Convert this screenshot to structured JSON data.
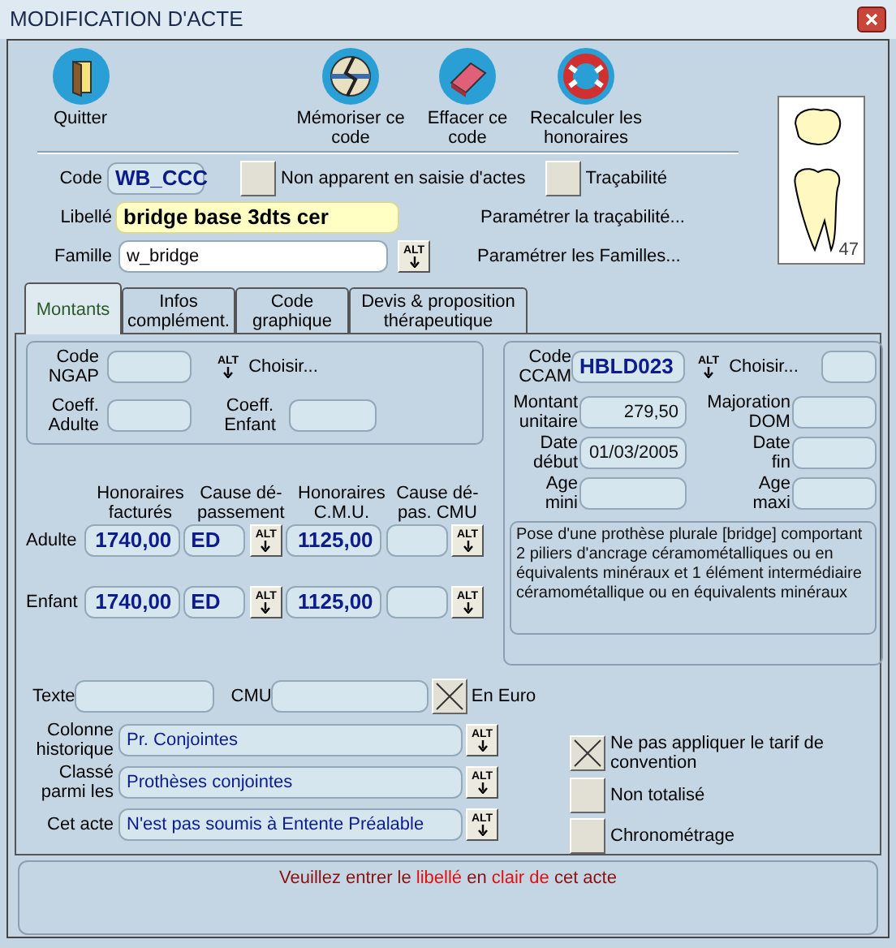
{
  "window": {
    "title": "MODIFICATION D'ACTE"
  },
  "toolbar": [
    {
      "label": "Quitter",
      "kind": "door"
    },
    {
      "label": "Mémoriser ce\ncode",
      "kind": "memorize"
    },
    {
      "label": "Effacer ce\ncode",
      "kind": "eraser"
    },
    {
      "label": "Recalculer les\nhonoraires",
      "kind": "lifebuoy"
    }
  ],
  "tooth": {
    "number": "47"
  },
  "code": {
    "label": "Code",
    "value": "WB_CCC"
  },
  "top_checks": [
    {
      "label": "Non apparent en saisie d'actes",
      "checked": false
    },
    {
      "label": "Traçabilité",
      "checked": false
    }
  ],
  "libelle": {
    "label": "Libellé",
    "value": "bridge base 3dts cer"
  },
  "famille": {
    "label": "Famille",
    "value": "w_bridge",
    "alt": "ALT"
  },
  "links": [
    "Paramétrer la traçabilité...",
    "Paramétrer les Familles..."
  ],
  "tabs": [
    {
      "label": "Montants",
      "selected": true
    },
    {
      "label": "Infos\ncomplément.",
      "selected": false
    },
    {
      "label": "Code\ngraphique",
      "selected": false
    },
    {
      "label": "Devis & proposition\nthérapeutique",
      "selected": false
    }
  ],
  "ngap": {
    "code_label": "Code\nNGAP",
    "alt": "ALT",
    "choose": "Choisir...",
    "coeff_adult_label": "Coeff.\nAdulte",
    "coeff_child_label": "Coeff.\nEnfant"
  },
  "fees": {
    "columns": [
      "Honoraires\nfacturés",
      "Cause dé-\npassement",
      "Honoraires\nC.M.U.",
      "Cause dé-\npas. CMU"
    ],
    "rows": [
      {
        "label": "Adulte",
        "billed": "1740,00",
        "cause": "ED",
        "cause_alt": "ALT",
        "cmu": "1125,00",
        "cmu_cause_alt": "ALT"
      },
      {
        "label": "Enfant",
        "billed": "1740,00",
        "cause": "ED",
        "cause_alt": "ALT",
        "cmu": "1125,00",
        "cmu_cause_alt": "ALT"
      }
    ]
  },
  "ccam": {
    "code_label": "Code\nCCAM",
    "code_value": "HBLD023",
    "alt": "ALT",
    "choose": "Choisir...",
    "fields": [
      {
        "label": "Montant\nunitaire",
        "value": "279,50"
      },
      {
        "label": "Majoration\nDOM"
      },
      {
        "label": "Date\ndébut",
        "value": "01/03/2005"
      },
      {
        "label": "Date\nfin"
      },
      {
        "label": "Age\nmini"
      },
      {
        "label": "Age\nmaxi"
      }
    ],
    "description": "Pose d'une prothèse plurale [bridge] comportant 2 piliers d'ancrage céramométalliques ou en équivalents minéraux et 1 élément intermédiaire céramométallique ou en équivalents minéraux"
  },
  "texte": {
    "label": "Texte"
  },
  "cmu": {
    "label": "CMU"
  },
  "en_euro": {
    "label": "En Euro",
    "checked": true
  },
  "selects": [
    {
      "label": "Colonne\nhistorique",
      "value": "Pr. Conjointes",
      "alt": "ALT"
    },
    {
      "label": "Classé\nparmi les",
      "value": "Prothèses conjointes",
      "alt": "ALT"
    },
    {
      "label": "Cet acte",
      "value": "N'est pas soumis à Entente Préalable",
      "alt": "ALT"
    }
  ],
  "options": [
    {
      "label": "Ne pas appliquer le tarif de convention",
      "checked": true
    },
    {
      "label": "Non totalisé",
      "checked": false
    },
    {
      "label": "Chronométrage",
      "checked": false
    }
  ],
  "message": [
    {
      "text": "Veuillez entrer le ",
      "highlight": false
    },
    {
      "text": "libellé",
      "highlight": true
    },
    {
      "text": " en ",
      "highlight": false
    },
    {
      "text": "clair de",
      "highlight": true
    },
    {
      "text": " cet acte",
      "highlight": false
    }
  ]
}
